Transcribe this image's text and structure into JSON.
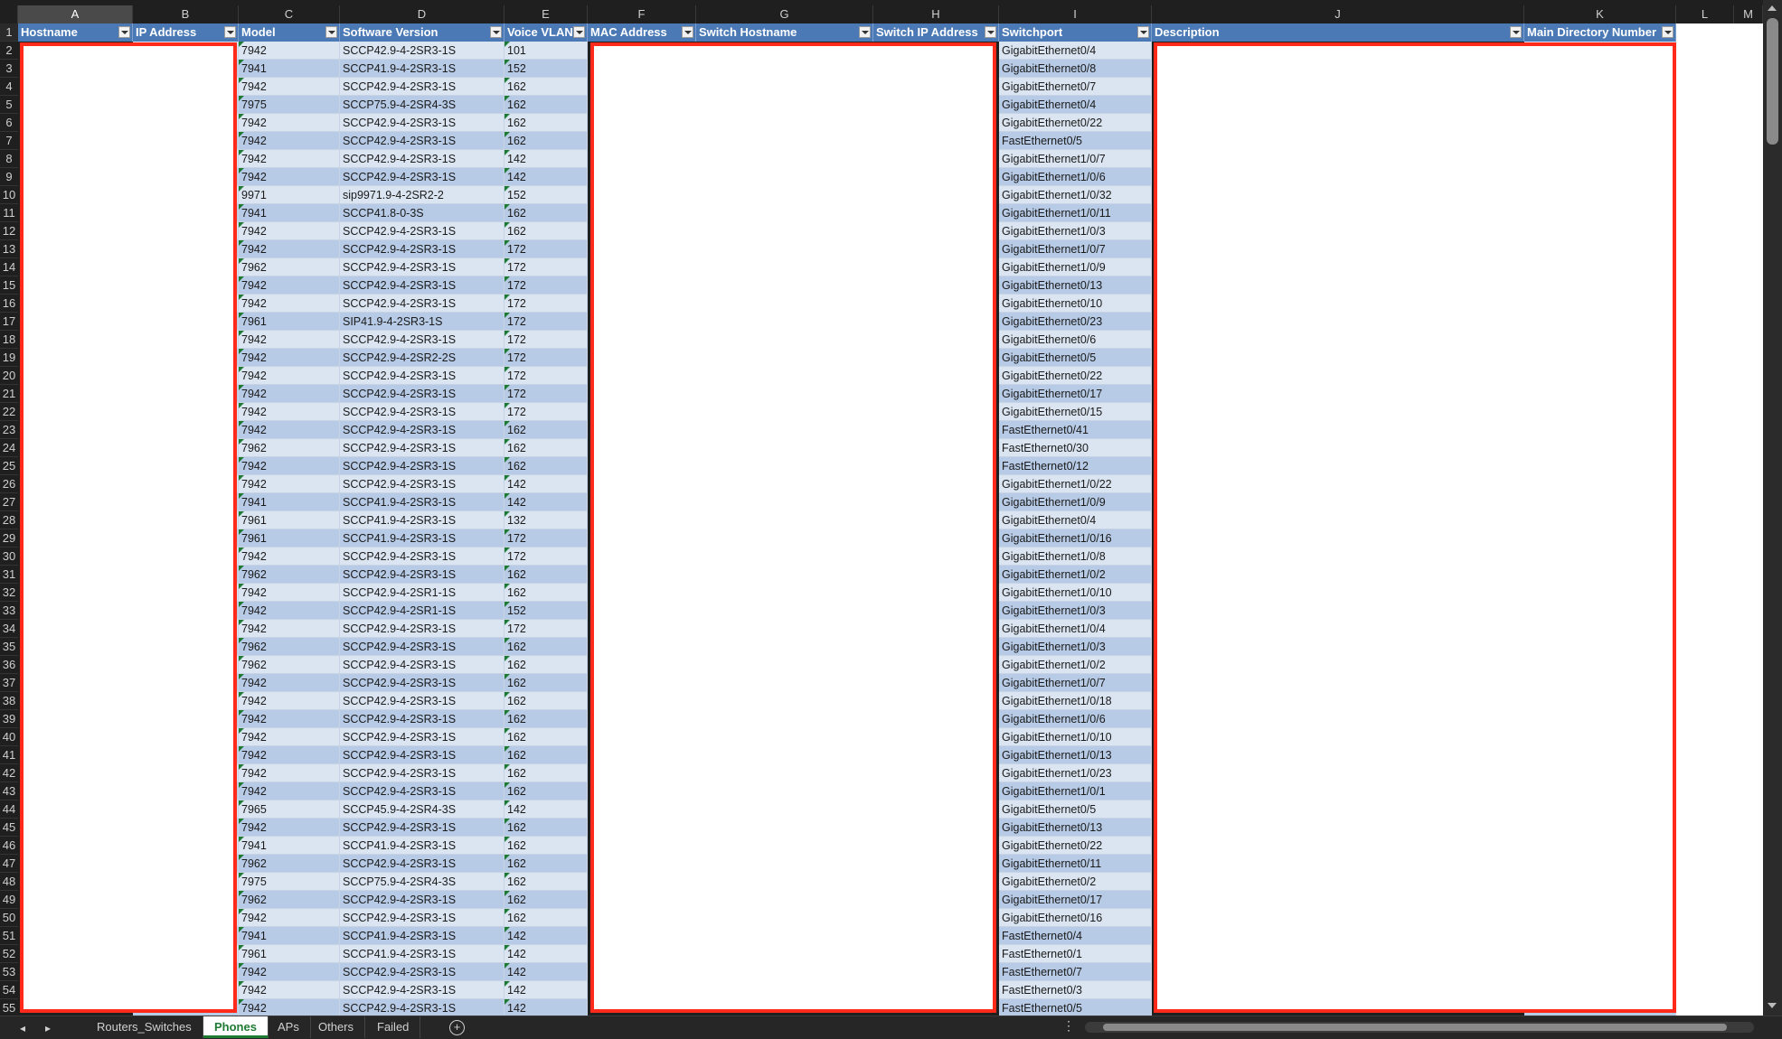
{
  "columns": [
    "A",
    "B",
    "C",
    "D",
    "E",
    "F",
    "G",
    "H",
    "I",
    "J",
    "K",
    "L",
    "M"
  ],
  "selected_column": "A",
  "headers": {
    "A": "Hostname",
    "B": "IP Address",
    "C": "Model",
    "D": "Software Version",
    "E": "Voice VLAN",
    "F": "MAC Address",
    "G": "Switch Hostname",
    "H": "Switch IP Address",
    "I": "Switchport",
    "J": "Description",
    "K": "Main Directory Number"
  },
  "rows": [
    {
      "n": "2",
      "model": "7942",
      "sw": "SCCP42.9-4-2SR3-1S",
      "vlan": "101",
      "port": "GigabitEthernet0/4"
    },
    {
      "n": "3",
      "model": "7941",
      "sw": "SCCP41.9-4-2SR3-1S",
      "vlan": "152",
      "port": "GigabitEthernet0/8"
    },
    {
      "n": "4",
      "model": "7942",
      "sw": "SCCP42.9-4-2SR3-1S",
      "vlan": "162",
      "port": "GigabitEthernet0/7"
    },
    {
      "n": "5",
      "model": "7975",
      "sw": "SCCP75.9-4-2SR4-3S",
      "vlan": "162",
      "port": "GigabitEthernet0/4"
    },
    {
      "n": "6",
      "model": "7942",
      "sw": "SCCP42.9-4-2SR3-1S",
      "vlan": "162",
      "port": "GigabitEthernet0/22"
    },
    {
      "n": "7",
      "model": "7942",
      "sw": "SCCP42.9-4-2SR3-1S",
      "vlan": "162",
      "port": "FastEthernet0/5"
    },
    {
      "n": "8",
      "model": "7942",
      "sw": "SCCP42.9-4-2SR3-1S",
      "vlan": "142",
      "port": "GigabitEthernet1/0/7"
    },
    {
      "n": "9",
      "model": "7942",
      "sw": "SCCP42.9-4-2SR3-1S",
      "vlan": "142",
      "port": "GigabitEthernet1/0/6"
    },
    {
      "n": "10",
      "model": "9971",
      "sw": "sip9971.9-4-2SR2-2",
      "vlan": "152",
      "port": "GigabitEthernet1/0/32"
    },
    {
      "n": "11",
      "model": "7941",
      "sw": "SCCP41.8-0-3S",
      "vlan": "162",
      "port": "GigabitEthernet1/0/11"
    },
    {
      "n": "12",
      "model": "7942",
      "sw": "SCCP42.9-4-2SR3-1S",
      "vlan": "162",
      "port": "GigabitEthernet1/0/3"
    },
    {
      "n": "13",
      "model": "7942",
      "sw": "SCCP42.9-4-2SR3-1S",
      "vlan": "172",
      "port": "GigabitEthernet1/0/7"
    },
    {
      "n": "14",
      "model": "7962",
      "sw": "SCCP42.9-4-2SR3-1S",
      "vlan": "172",
      "port": "GigabitEthernet1/0/9"
    },
    {
      "n": "15",
      "model": "7942",
      "sw": "SCCP42.9-4-2SR3-1S",
      "vlan": "172",
      "port": "GigabitEthernet0/13"
    },
    {
      "n": "16",
      "model": "7942",
      "sw": "SCCP42.9-4-2SR3-1S",
      "vlan": "172",
      "port": "GigabitEthernet0/10"
    },
    {
      "n": "17",
      "model": "7961",
      "sw": "SIP41.9-4-2SR3-1S",
      "vlan": "172",
      "port": "GigabitEthernet0/23"
    },
    {
      "n": "18",
      "model": "7942",
      "sw": "SCCP42.9-4-2SR3-1S",
      "vlan": "172",
      "port": "GigabitEthernet0/6"
    },
    {
      "n": "19",
      "model": "7942",
      "sw": "SCCP42.9-4-2SR2-2S",
      "vlan": "172",
      "port": "GigabitEthernet0/5"
    },
    {
      "n": "20",
      "model": "7942",
      "sw": "SCCP42.9-4-2SR3-1S",
      "vlan": "172",
      "port": "GigabitEthernet0/22"
    },
    {
      "n": "21",
      "model": "7942",
      "sw": "SCCP42.9-4-2SR3-1S",
      "vlan": "172",
      "port": "GigabitEthernet0/17"
    },
    {
      "n": "22",
      "model": "7942",
      "sw": "SCCP42.9-4-2SR3-1S",
      "vlan": "172",
      "port": "GigabitEthernet0/15"
    },
    {
      "n": "23",
      "model": "7942",
      "sw": "SCCP42.9-4-2SR3-1S",
      "vlan": "162",
      "port": "FastEthernet0/41"
    },
    {
      "n": "24",
      "model": "7962",
      "sw": "SCCP42.9-4-2SR3-1S",
      "vlan": "162",
      "port": "FastEthernet0/30"
    },
    {
      "n": "25",
      "model": "7942",
      "sw": "SCCP42.9-4-2SR3-1S",
      "vlan": "162",
      "port": "FastEthernet0/12"
    },
    {
      "n": "26",
      "model": "7942",
      "sw": "SCCP42.9-4-2SR3-1S",
      "vlan": "142",
      "port": "GigabitEthernet1/0/22"
    },
    {
      "n": "27",
      "model": "7941",
      "sw": "SCCP41.9-4-2SR3-1S",
      "vlan": "142",
      "port": "GigabitEthernet1/0/9"
    },
    {
      "n": "28",
      "model": "7961",
      "sw": "SCCP41.9-4-2SR3-1S",
      "vlan": "132",
      "port": "GigabitEthernet0/4"
    },
    {
      "n": "29",
      "model": "7961",
      "sw": "SCCP41.9-4-2SR3-1S",
      "vlan": "172",
      "port": "GigabitEthernet1/0/16"
    },
    {
      "n": "30",
      "model": "7942",
      "sw": "SCCP42.9-4-2SR3-1S",
      "vlan": "172",
      "port": "GigabitEthernet1/0/8"
    },
    {
      "n": "31",
      "model": "7962",
      "sw": "SCCP42.9-4-2SR3-1S",
      "vlan": "162",
      "port": "GigabitEthernet1/0/2"
    },
    {
      "n": "32",
      "model": "7942",
      "sw": "SCCP42.9-4-2SR1-1S",
      "vlan": "162",
      "port": "GigabitEthernet1/0/10"
    },
    {
      "n": "33",
      "model": "7942",
      "sw": "SCCP42.9-4-2SR1-1S",
      "vlan": "152",
      "port": "GigabitEthernet1/0/3"
    },
    {
      "n": "34",
      "model": "7942",
      "sw": "SCCP42.9-4-2SR3-1S",
      "vlan": "172",
      "port": "GigabitEthernet1/0/4"
    },
    {
      "n": "35",
      "model": "7962",
      "sw": "SCCP42.9-4-2SR3-1S",
      "vlan": "162",
      "port": "GigabitEthernet1/0/3"
    },
    {
      "n": "36",
      "model": "7962",
      "sw": "SCCP42.9-4-2SR3-1S",
      "vlan": "162",
      "port": "GigabitEthernet1/0/2"
    },
    {
      "n": "37",
      "model": "7942",
      "sw": "SCCP42.9-4-2SR3-1S",
      "vlan": "162",
      "port": "GigabitEthernet1/0/7"
    },
    {
      "n": "38",
      "model": "7942",
      "sw": "SCCP42.9-4-2SR3-1S",
      "vlan": "162",
      "port": "GigabitEthernet1/0/18"
    },
    {
      "n": "39",
      "model": "7942",
      "sw": "SCCP42.9-4-2SR3-1S",
      "vlan": "162",
      "port": "GigabitEthernet1/0/6"
    },
    {
      "n": "40",
      "model": "7942",
      "sw": "SCCP42.9-4-2SR3-1S",
      "vlan": "162",
      "port": "GigabitEthernet1/0/10"
    },
    {
      "n": "41",
      "model": "7942",
      "sw": "SCCP42.9-4-2SR3-1S",
      "vlan": "162",
      "port": "GigabitEthernet1/0/13"
    },
    {
      "n": "42",
      "model": "7942",
      "sw": "SCCP42.9-4-2SR3-1S",
      "vlan": "162",
      "port": "GigabitEthernet1/0/23"
    },
    {
      "n": "43",
      "model": "7942",
      "sw": "SCCP42.9-4-2SR3-1S",
      "vlan": "162",
      "port": "GigabitEthernet1/0/1"
    },
    {
      "n": "44",
      "model": "7965",
      "sw": "SCCP45.9-4-2SR4-3S",
      "vlan": "142",
      "port": "GigabitEthernet0/5"
    },
    {
      "n": "45",
      "model": "7942",
      "sw": "SCCP42.9-4-2SR3-1S",
      "vlan": "162",
      "port": "GigabitEthernet0/13"
    },
    {
      "n": "46",
      "model": "7941",
      "sw": "SCCP41.9-4-2SR3-1S",
      "vlan": "162",
      "port": "GigabitEthernet0/22"
    },
    {
      "n": "47",
      "model": "7962",
      "sw": "SCCP42.9-4-2SR3-1S",
      "vlan": "162",
      "port": "GigabitEthernet0/11"
    },
    {
      "n": "48",
      "model": "7975",
      "sw": "SCCP75.9-4-2SR4-3S",
      "vlan": "162",
      "port": "GigabitEthernet0/2"
    },
    {
      "n": "49",
      "model": "7962",
      "sw": "SCCP42.9-4-2SR3-1S",
      "vlan": "162",
      "port": "GigabitEthernet0/17"
    },
    {
      "n": "50",
      "model": "7942",
      "sw": "SCCP42.9-4-2SR3-1S",
      "vlan": "162",
      "port": "GigabitEthernet0/16"
    },
    {
      "n": "51",
      "model": "7941",
      "sw": "SCCP41.9-4-2SR3-1S",
      "vlan": "142",
      "port": "FastEthernet0/4"
    },
    {
      "n": "52",
      "model": "7961",
      "sw": "SCCP41.9-4-2SR3-1S",
      "vlan": "142",
      "port": "FastEthernet0/1"
    },
    {
      "n": "53",
      "model": "7942",
      "sw": "SCCP42.9-4-2SR3-1S",
      "vlan": "142",
      "port": "FastEthernet0/7"
    },
    {
      "n": "54",
      "model": "7942",
      "sw": "SCCP42.9-4-2SR3-1S",
      "vlan": "142",
      "port": "FastEthernet0/3"
    },
    {
      "n": "55",
      "model": "7942",
      "sw": "SCCP42.9-4-2SR3-1S",
      "vlan": "142",
      "port": "FastEthernet0/5"
    }
  ],
  "header_row_number": "1",
  "sheet_tabs": [
    {
      "label": "Routers_Switches",
      "active": false
    },
    {
      "label": "Phones",
      "active": true
    },
    {
      "label": "APs",
      "active": false
    },
    {
      "label": "Others",
      "active": false
    },
    {
      "label": "Failed",
      "active": false
    }
  ],
  "icons": {
    "add_sheet": "plus-circle-icon",
    "filter": "filter-dropdown-icon",
    "nav_prev": "chevron-left-icon",
    "nav_next": "chevron-right-icon",
    "options": "more-options-icon"
  },
  "colors": {
    "header_fill": "#4b79b5",
    "band_dark": "#b7cbe6",
    "band_light": "#dbe5f1",
    "redaction_border": "#ff2a1a",
    "error_indicator": "#1e7b34",
    "active_tab_text": "#1e7b34"
  }
}
